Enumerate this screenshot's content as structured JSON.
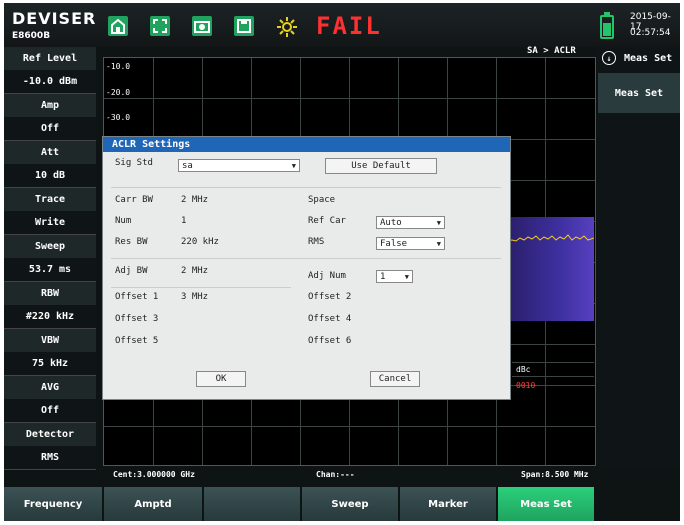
{
  "header": {
    "brand": "DEVISER",
    "model": "E8600B",
    "status": "FAIL",
    "date": "2015-09-17",
    "time": "02:57:54",
    "icons": [
      "home-icon",
      "fullscreen-icon",
      "camera-icon",
      "save-icon",
      "sun-icon"
    ]
  },
  "left_panel": [
    {
      "label": "Ref Level",
      "value": "-10.0 dBm"
    },
    {
      "label": "Amp",
      "value": "Off"
    },
    {
      "label": "Att",
      "value": "10 dB"
    },
    {
      "label": "Trace",
      "value": "Write"
    },
    {
      "label": "Sweep",
      "value": "53.7 ms"
    },
    {
      "label": "RBW",
      "value": "#220 kHz"
    },
    {
      "label": "VBW",
      "value": "75 kHz"
    },
    {
      "label": "AVG",
      "value": "Off"
    },
    {
      "label": "Detector",
      "value": "RMS"
    }
  ],
  "right_panel": {
    "title": "Meas Set",
    "button": "Meas Set"
  },
  "graph": {
    "breadcrumb": "SA > ACLR",
    "y_labels": [
      "-10.0",
      "-20.0",
      "-30.0"
    ],
    "table_header": "dBc",
    "table_value": "0010",
    "center": "Cent:3.000000 GHz",
    "chan": "Chan:---",
    "span": "Span:8.500 MHz"
  },
  "dialog": {
    "title": "ACLR Settings",
    "sig_std_label": "Sig Std",
    "sig_std_value": "sa",
    "use_default": "Use Default",
    "carr_bw_label": "Carr BW",
    "carr_bw_value": "2 MHz",
    "space_label": "Space",
    "num_label": "Num",
    "num_value": "1",
    "ref_car_label": "Ref Car",
    "ref_car_value": "Auto",
    "res_bw_label": "Res BW",
    "res_bw_value": "220 kHz",
    "rms_label": "RMS",
    "rms_value": "False",
    "adj_bw_label": "Adj BW",
    "adj_bw_value": "2 MHz",
    "adj_num_label": "Adj Num",
    "adj_num_value": "1",
    "offset1_label": "Offset 1",
    "offset1_value": "3 MHz",
    "offset2_label": "Offset 2",
    "offset3_label": "Offset 3",
    "offset4_label": "Offset 4",
    "offset5_label": "Offset 5",
    "offset6_label": "Offset 6",
    "ok": "OK",
    "cancel": "Cancel"
  },
  "softkeys": [
    "Frequency",
    "Amptd",
    "",
    "Sweep",
    "Marker",
    "Meas Set"
  ],
  "colors": {
    "accent": "#1fa35f",
    "fail": "#ff3030",
    "title_bar": "#1f66b7"
  }
}
